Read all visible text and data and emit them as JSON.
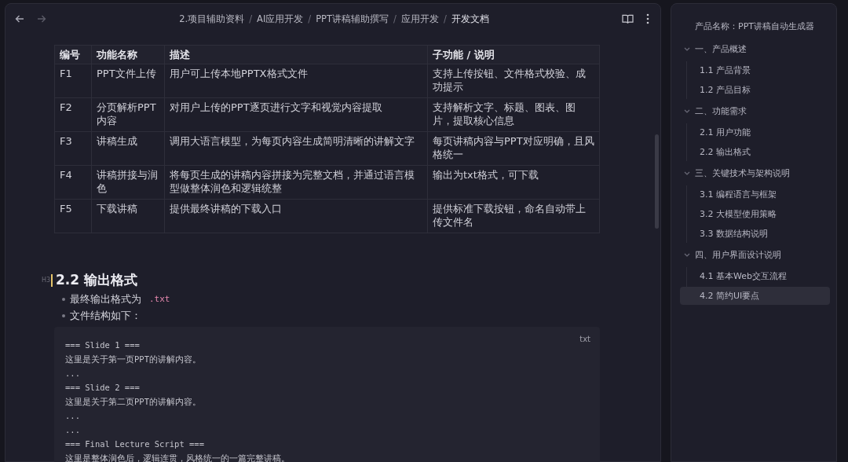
{
  "breadcrumb_separator": "/",
  "breadcrumb": [
    "2.项目辅助资料",
    "AI应用开发",
    "PPT讲稿辅助撰写",
    "应用开发",
    "开发文档"
  ],
  "table": {
    "columns": [
      "编号",
      "功能名称",
      "描述",
      "子功能 / 说明"
    ],
    "rows": [
      [
        "F1",
        "PPT文件上传",
        "用户可上传本地PPTX格式文件",
        "支持上传按钮、文件格式校验、成功提示"
      ],
      [
        "F2",
        "分页解析PPT内容",
        "对用户上传的PPT逐页进行文字和视觉内容提取",
        "支持解析文字、标题、图表、图片，提取核心信息"
      ],
      [
        "F3",
        "讲稿生成",
        "调用大语言模型，为每页内容生成简明清晰的讲解文字",
        "每页讲稿内容与PPT对应明确，且风格统一"
      ],
      [
        "F4",
        "讲稿拼接与润色",
        "将每页生成的讲稿内容拼接为完整文档，并通过语言模型做整体润色和逻辑统整",
        "输出为txt格式，可下载"
      ],
      [
        "F5",
        "下载讲稿",
        "提供最终讲稿的下载入口",
        "提供标准下载按钮，命名自动带上传文件名"
      ]
    ]
  },
  "heading": {
    "level_tag": "H3",
    "text": "2.2 输出格式"
  },
  "bullets": [
    {
      "text": "最终输出格式为",
      "code": ".txt"
    },
    {
      "text": "文件结构如下："
    }
  ],
  "code_block": {
    "language": "txt",
    "lines": [
      "=== Slide 1 ===",
      "这里是关于第一页PPT的讲解内容。",
      "...",
      "=== Slide 2 ===",
      "这里是关于第二页PPT的讲解内容。",
      "...",
      "...",
      "=== Final Lecture Script ===",
      "这里是整体润色后，逻辑连贯，风格统一的一篇完整讲稿。"
    ]
  },
  "outline": {
    "title": "产品名称：PPT讲稿自动生成器",
    "items": [
      {
        "label": "一、产品概述",
        "expanded": true,
        "selected": false,
        "children": [
          {
            "label": "1.1 产品背景",
            "selected": false
          },
          {
            "label": "1.2 产品目标",
            "selected": false
          }
        ]
      },
      {
        "label": "二、功能需求",
        "expanded": true,
        "selected": false,
        "children": [
          {
            "label": "2.1 用户功能",
            "selected": false
          },
          {
            "label": "2.2 输出格式",
            "selected": false
          }
        ]
      },
      {
        "label": "三、关键技术与架构说明",
        "expanded": true,
        "selected": false,
        "children": [
          {
            "label": "3.1 编程语言与框架",
            "selected": false
          },
          {
            "label": "3.2 大模型使用策略",
            "selected": false
          },
          {
            "label": "3.3 数据结构说明",
            "selected": false
          }
        ]
      },
      {
        "label": "四、用户界面设计说明",
        "expanded": true,
        "selected": false,
        "children": [
          {
            "label": "4.1 基本Web交互流程",
            "selected": false
          },
          {
            "label": "4.2 简约UI要点",
            "selected": true
          }
        ]
      }
    ]
  }
}
